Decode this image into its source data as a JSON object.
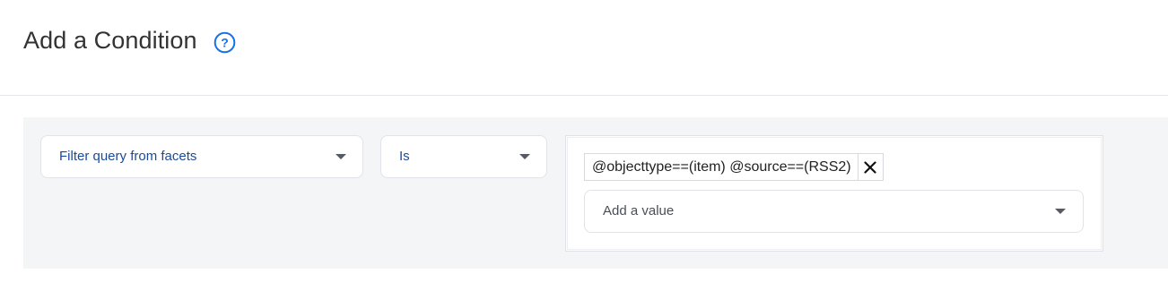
{
  "header": {
    "title": "Add a Condition",
    "help_icon": "question-circle-icon",
    "accent_color": "#1372ec"
  },
  "condition": {
    "field": {
      "selected": "Filter query from facets",
      "icon": "caret-down-icon"
    },
    "operator": {
      "selected": "Is",
      "icon": "caret-down-icon"
    },
    "values": {
      "chips": [
        {
          "text": "@objecttype==(item) @source==(RSS2)",
          "remove_icon": "close-icon"
        }
      ],
      "add_placeholder": "Add a value",
      "icon": "caret-down-icon"
    }
  },
  "colors": {
    "panel_background": "#f4f5f7",
    "dropdown_text": "#1b4a9c",
    "border": "#e1e3e8"
  }
}
